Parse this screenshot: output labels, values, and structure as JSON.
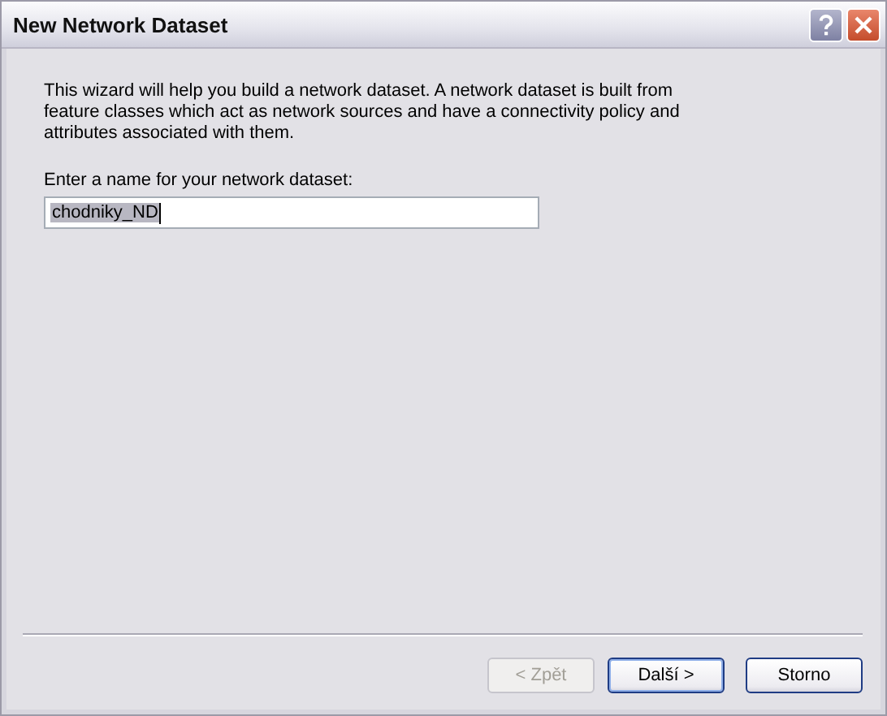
{
  "window": {
    "title": "New Network Dataset"
  },
  "intro": "This wizard will help you build a network dataset.  A network dataset is built from feature classes which act as network sources and have a connectivity policy and attributes associated with them.",
  "name_field": {
    "label": "Enter a name for your network dataset:",
    "value": "chodniky_ND",
    "selected": true
  },
  "buttons": [
    {
      "label": "< Zpět",
      "disabled": true,
      "default": false
    },
    {
      "label": "Další >",
      "disabled": false,
      "default": true
    },
    {
      "label": "Storno",
      "disabled": false,
      "default": false
    }
  ]
}
